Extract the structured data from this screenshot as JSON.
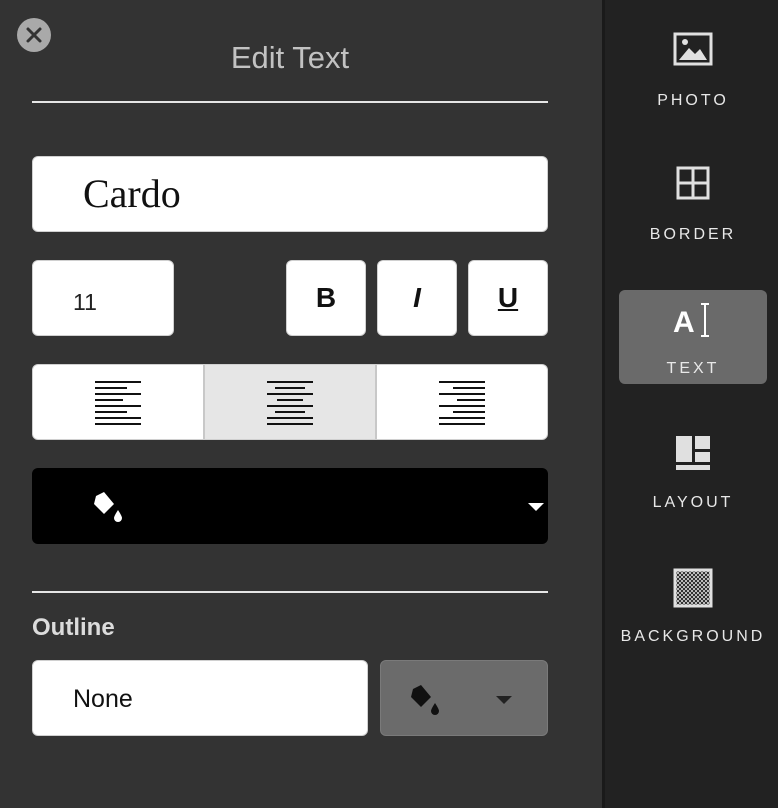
{
  "panel": {
    "title": "Edit Text",
    "font_name": "Cardo",
    "font_size": "11",
    "bold_label": "B",
    "italic_label": "I",
    "underline_label": "U",
    "alignment": [
      "left",
      "center",
      "right"
    ],
    "alignment_selected": "center",
    "text_color": "#000000",
    "outline_label": "Outline",
    "outline_value": "None",
    "outline_color": "#6b6b6b"
  },
  "sidebar": {
    "items": [
      {
        "label": "PHOTO",
        "icon": "image-icon"
      },
      {
        "label": "BORDER",
        "icon": "grid-icon"
      },
      {
        "label": "TEXT",
        "icon": "text-cursor-icon",
        "active": true
      },
      {
        "label": "LAYOUT",
        "icon": "layout-icon"
      },
      {
        "label": "BACKGROUND",
        "icon": "checker-icon"
      }
    ]
  }
}
